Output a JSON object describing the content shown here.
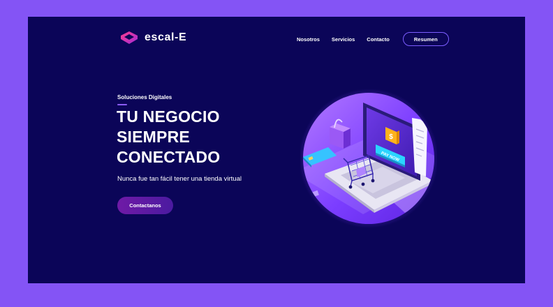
{
  "brand": {
    "name": "escal-E"
  },
  "nav": {
    "items": [
      "Nosotros",
      "Servicios",
      "Contacto"
    ],
    "cta": "Resumen"
  },
  "hero": {
    "eyebrow": "Soluciones Digitales",
    "headline": [
      "TU NEGOCIO",
      "SIEMPRE",
      "CONECTADO"
    ],
    "subtitle": "Nunca fue tan fácil tener una tienda virtual",
    "cta": "Contactanos"
  },
  "illustration": {
    "card_label": "PAY NOW",
    "coin_symbol": "$"
  },
  "colors": {
    "frame": "#8454f5",
    "background": "#0b0558",
    "accent": "#8b5cf6",
    "button_gradient_start": "#6f1aa6",
    "button_gradient_end": "#4b1aa0"
  }
}
